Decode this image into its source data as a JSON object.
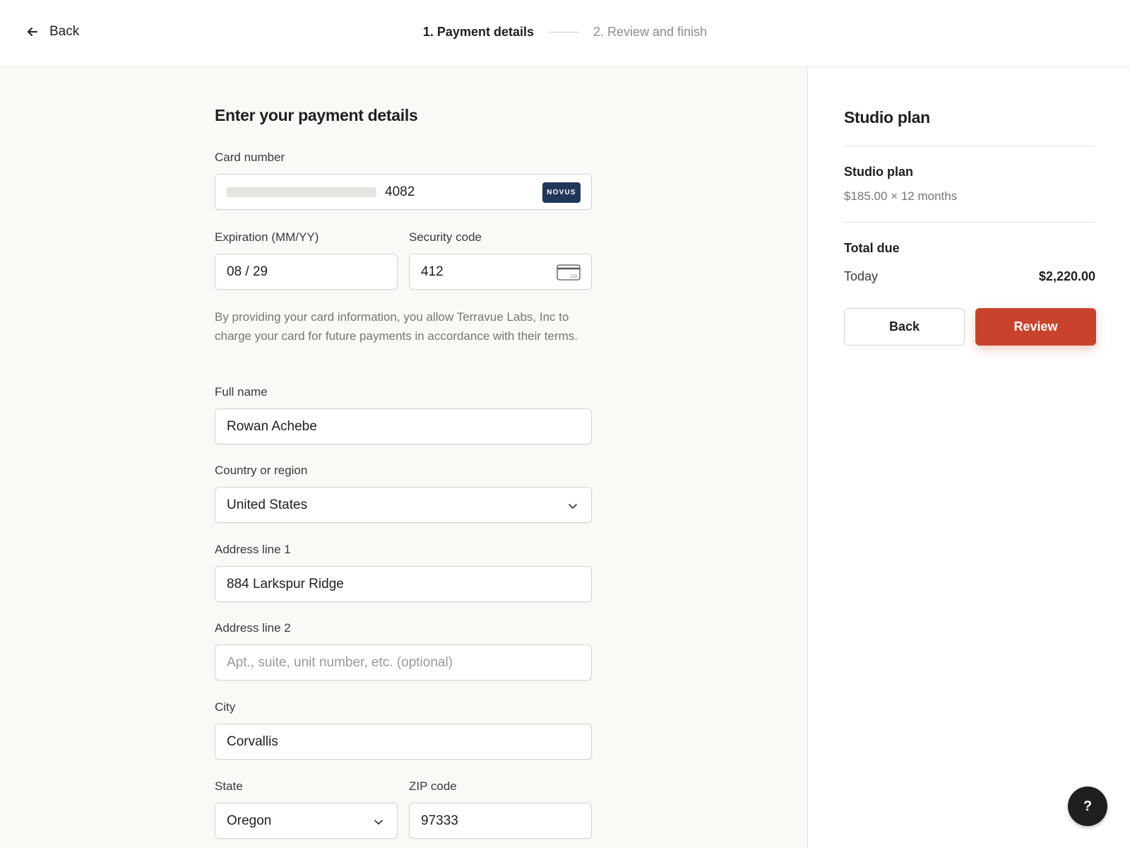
{
  "header": {
    "back_label": "Back",
    "steps": [
      {
        "label": "1. Payment details",
        "active": true
      },
      {
        "label": "2. Review and finish",
        "active": false
      }
    ]
  },
  "form": {
    "title": "Enter your payment details",
    "card_number": {
      "label": "Card number",
      "value": "4082",
      "brand": "NOVUS"
    },
    "expiration": {
      "label": "Expiration (MM/YY)",
      "value": "08 / 29"
    },
    "security_code": {
      "label": "Security code",
      "value": "412"
    },
    "authorization_text": "By providing your card information, you allow Terravue Labs, Inc to charge your card for future payments in accordance with their terms.",
    "full_name": {
      "label": "Full name",
      "value": "Rowan Achebe"
    },
    "country": {
      "label": "Country or region",
      "value": "United States"
    },
    "address1": {
      "label": "Address line 1",
      "value": "884 Larkspur Ridge"
    },
    "address2": {
      "label": "Address line 2",
      "placeholder": "Apt., suite, unit number, etc. (optional)"
    },
    "city": {
      "label": "City",
      "value": "Corvallis"
    },
    "state": {
      "label": "State",
      "value": "Oregon"
    },
    "zip": {
      "label": "ZIP code",
      "value": "97333"
    }
  },
  "summary": {
    "title": "Studio plan",
    "plan_name": "Studio plan",
    "plan_price": "$185.00 × 12 months",
    "total_label": "Total due",
    "today_label": "Today",
    "today_amount": "$2,220.00",
    "back_button": "Back",
    "review_button": "Review"
  },
  "help_button": "?",
  "colors": {
    "accent": "#c9432c",
    "card_brand": "#1f3759",
    "page_bg": "#faf9f6"
  }
}
